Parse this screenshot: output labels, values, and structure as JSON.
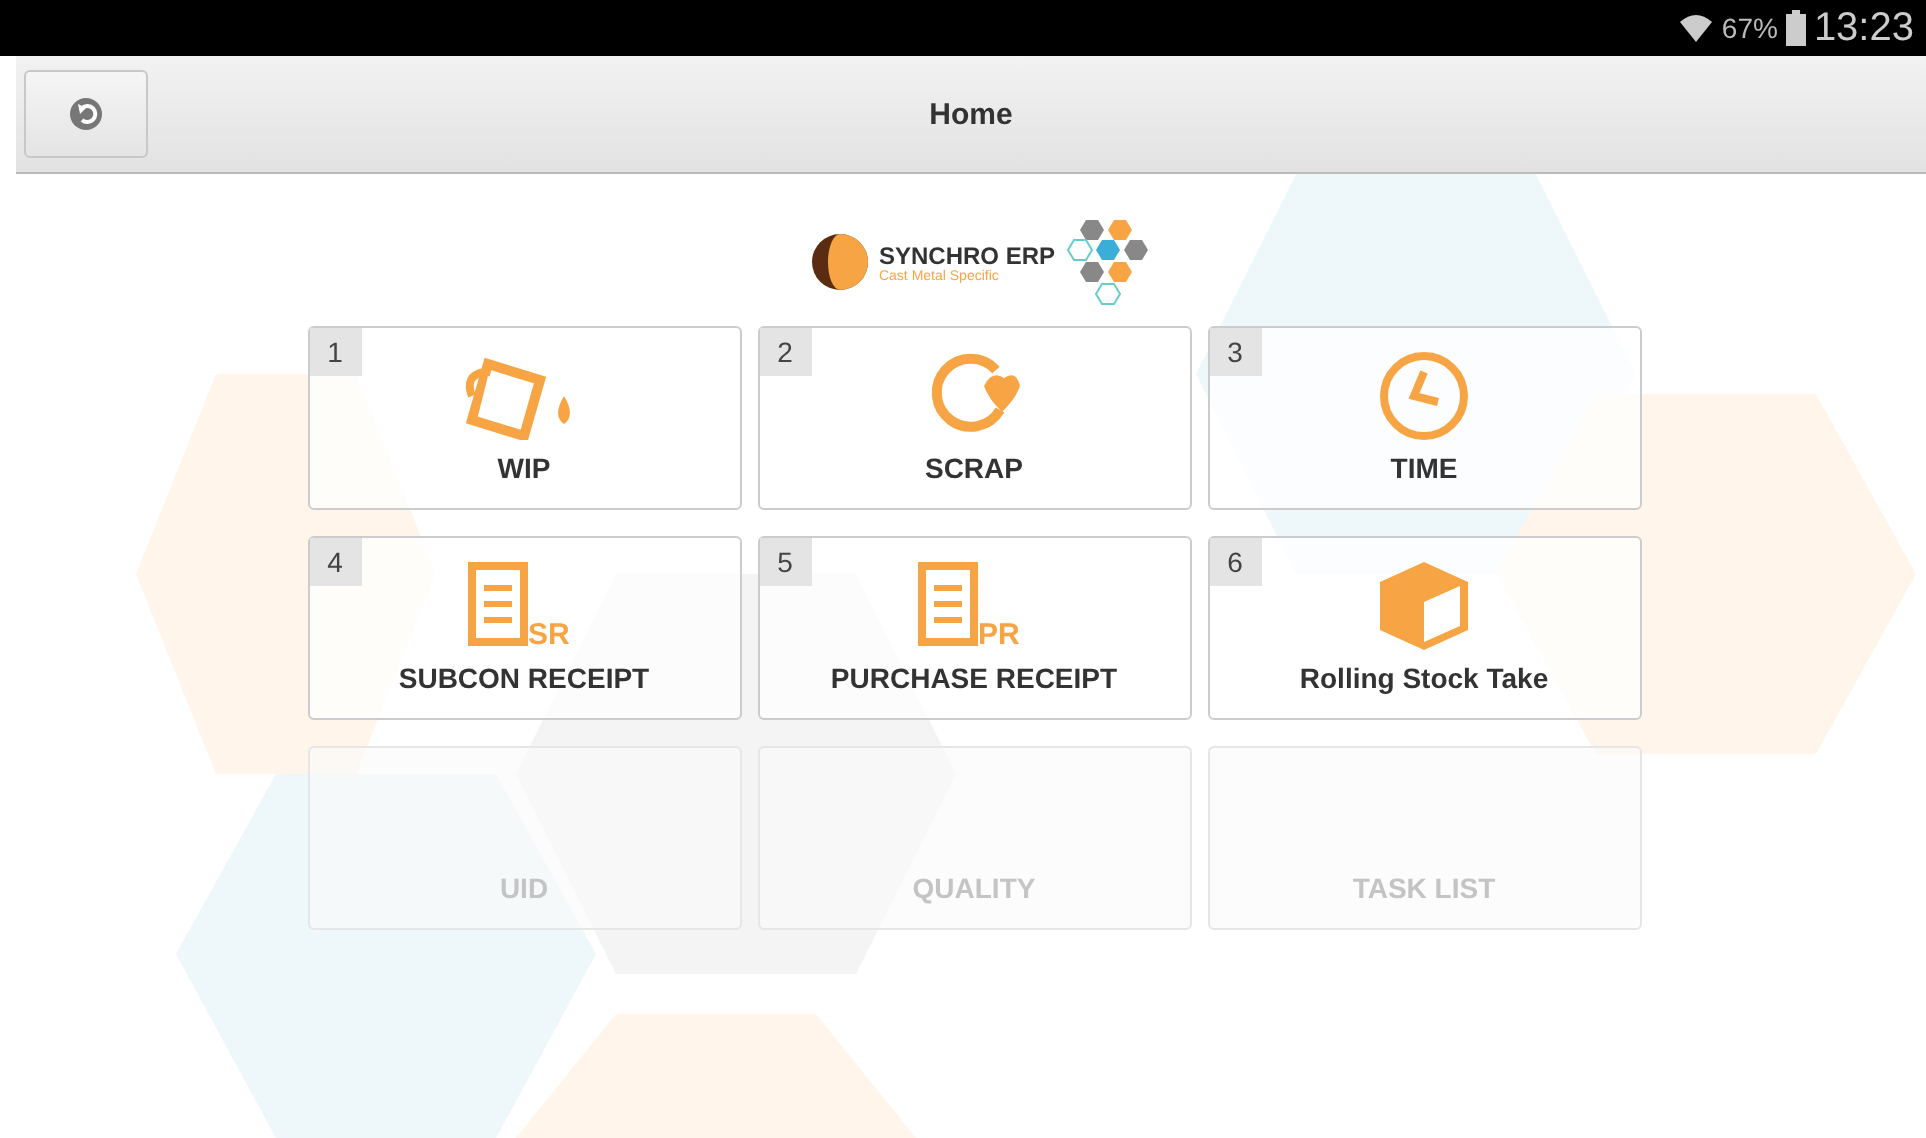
{
  "status_bar": {
    "battery": "67%",
    "time": "13:23"
  },
  "header": {
    "title": "Home"
  },
  "logo": {
    "name": "SYNCHRO ERP",
    "tagline": "Cast Metal Specific"
  },
  "tiles": [
    {
      "number": "1",
      "label": "WIP",
      "kind": "pour",
      "disabled": false
    },
    {
      "number": "2",
      "label": "SCRAP",
      "kind": "cycle",
      "disabled": false
    },
    {
      "number": "3",
      "label": "TIME",
      "kind": "clock",
      "disabled": false
    },
    {
      "number": "4",
      "label": "SUBCON RECEIPT",
      "kind": "doc",
      "badge": "SR",
      "disabled": false
    },
    {
      "number": "5",
      "label": "PURCHASE RECEIPT",
      "kind": "doc",
      "badge": "PR",
      "disabled": false
    },
    {
      "number": "6",
      "label": "Rolling Stock Take",
      "kind": "box",
      "disabled": false
    },
    {
      "label": "UID",
      "kind": "none",
      "disabled": true
    },
    {
      "label": "QUALITY",
      "kind": "none",
      "disabled": true
    },
    {
      "label": "TASK LIST",
      "kind": "none",
      "disabled": true
    }
  ]
}
